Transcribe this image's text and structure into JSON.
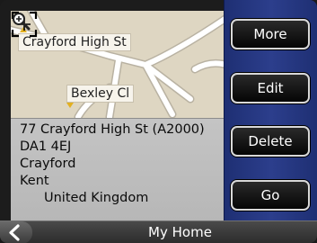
{
  "map": {
    "street_label_1": "Crayford High St",
    "street_label_2": "Bexley Cl",
    "zoom_icon": "magnifier-icon",
    "crosshair_icon": "crosshair-icon"
  },
  "address": {
    "line1": "77 Crayford High St (A2000)",
    "line2": "DA1 4EJ",
    "line3": "Crayford",
    "line4": "Kent",
    "country": "United Kingdom"
  },
  "buttons": {
    "more": "More",
    "edit": "Edit",
    "delete": "Delete",
    "go": "Go"
  },
  "footer": {
    "title": "My Home",
    "back_icon": "chevron-left-icon"
  },
  "colors": {
    "side_panel": "#2c3e8c",
    "map_background": "#ded6c2",
    "road": "#ffffff",
    "address_background": "#bdbdbd"
  }
}
